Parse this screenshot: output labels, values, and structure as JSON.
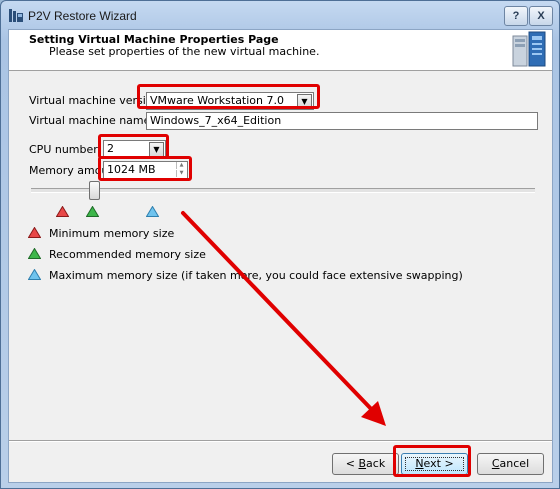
{
  "window": {
    "title": "P2V Restore Wizard",
    "help_label": "?",
    "close_label": "X"
  },
  "header": {
    "title": "Setting Virtual Machine Properties Page",
    "subtitle": "Please set properties of the new virtual machine."
  },
  "form": {
    "vm_version_label": "Virtual machine version:",
    "vm_version_value": "VMware Workstation 7.0",
    "vm_name_label": "Virtual machine name:",
    "vm_name_value": "Windows_7_x64_Edition",
    "cpu_label": "CPU number:",
    "cpu_value": "2",
    "memory_label": "Memory amount:",
    "memory_value": "1024 MB",
    "memory_slider_level_mb": 1024
  },
  "legend": {
    "min": "Minimum memory size",
    "recommended": "Recommended memory size",
    "max": "Maximum memory size (if taken more, you could face extensive swapping)"
  },
  "buttons": {
    "back_prefix": "< ",
    "back_accel": "B",
    "back_rest": "ack",
    "next_accel": "N",
    "next_rest": "ext >",
    "cancel_accel": "C",
    "cancel_rest": "ancel"
  },
  "colors": {
    "highlight": "#e00000",
    "min_marker": "#e84848",
    "recommended_marker": "#3db64a",
    "max_marker": "#6fc3ee"
  }
}
